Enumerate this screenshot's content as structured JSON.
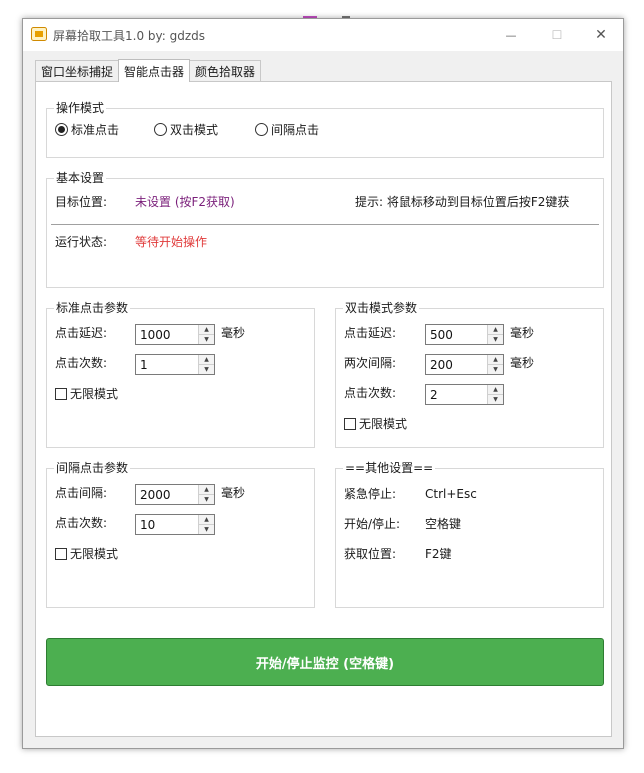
{
  "window": {
    "title": "屏幕拾取工具1.0    by:  gdzds",
    "controls": {
      "minimize": "—",
      "maximize": "☐",
      "close": "✕"
    }
  },
  "tabs": [
    {
      "label": "窗口坐标捕捉",
      "active": false
    },
    {
      "label": "智能点击器",
      "active": true
    },
    {
      "label": "颜色拾取器",
      "active": false
    }
  ],
  "mode": {
    "title": "操作模式",
    "options": [
      {
        "label": "标准点击",
        "selected": true
      },
      {
        "label": "双击模式",
        "selected": false
      },
      {
        "label": "间隔点击",
        "selected": false
      }
    ]
  },
  "basic": {
    "title": "基本设置",
    "target_label": "目标位置:",
    "target_value": "未设置 (按F2获取)",
    "hint": "提示: 将鼠标移动到目标位置后按F2键获",
    "status_label": "运行状态:",
    "status_value": "等待开始操作"
  },
  "standard": {
    "title": "标准点击参数",
    "delay_label": "点击延迟:",
    "delay_value": "1000",
    "delay_unit": "毫秒",
    "count_label": "点击次数:",
    "count_value": "1",
    "infinite_label": "无限模式"
  },
  "double": {
    "title": "双击模式参数",
    "delay_label": "点击延迟:",
    "delay_value": "500",
    "delay_unit": "毫秒",
    "interval_label": "两次间隔:",
    "interval_value": "200",
    "interval_unit": "毫秒",
    "count_label": "点击次数:",
    "count_value": "2",
    "infinite_label": "无限模式"
  },
  "interval": {
    "title": "间隔点击参数",
    "gap_label": "点击间隔:",
    "gap_value": "2000",
    "gap_unit": "毫秒",
    "count_label": "点击次数:",
    "count_value": "10",
    "infinite_label": "无限模式"
  },
  "other": {
    "title": "==其他设置==",
    "rows": [
      {
        "label": "紧急停止:",
        "value": "Ctrl+Esc"
      },
      {
        "label": "开始/停止:",
        "value": "空格键"
      },
      {
        "label": "获取位置:",
        "value": "F2键"
      }
    ]
  },
  "start_button": {
    "label": "开始/停止监控 (空格键)"
  },
  "colors": {
    "accent_green": "#4caf50",
    "target_purple": "#7a1f7a",
    "status_red": "#e03a3a"
  }
}
